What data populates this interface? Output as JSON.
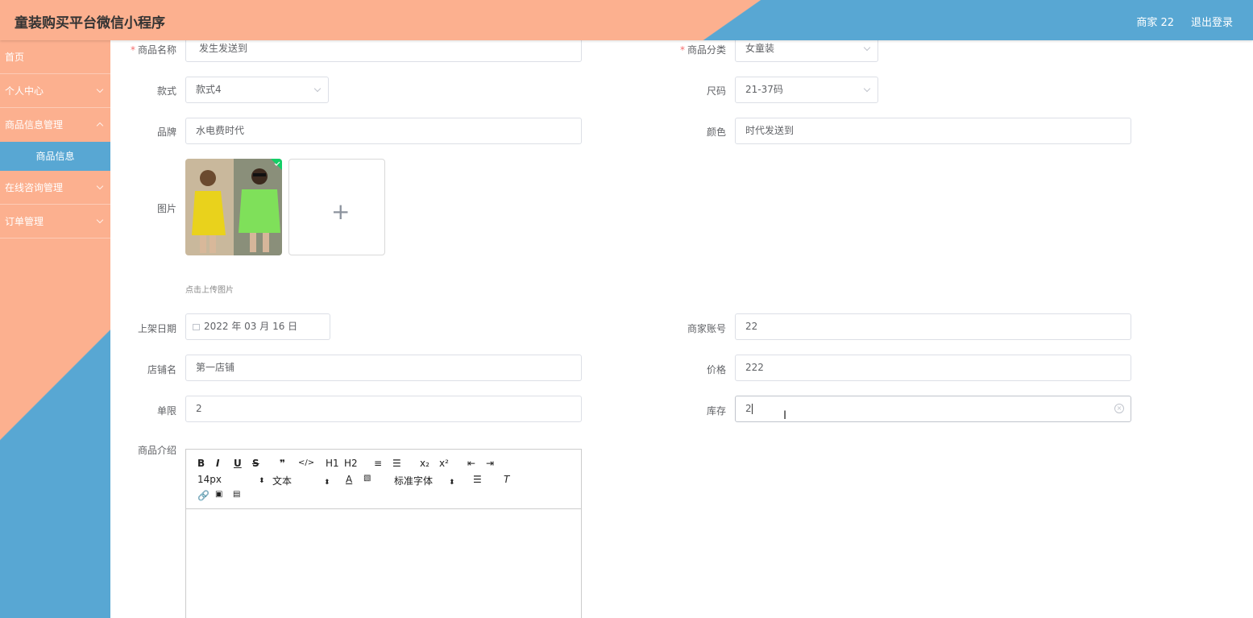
{
  "header": {
    "title": "童装购买平台微信小程序",
    "user": "商家 22",
    "logout": "退出登录"
  },
  "sidebar": {
    "items": [
      {
        "label": "首页"
      },
      {
        "label": "个人中心"
      },
      {
        "label": "商品信息管理"
      },
      {
        "label": "商品信息",
        "active": true
      },
      {
        "label": "在线咨询管理"
      },
      {
        "label": "订单管理"
      }
    ]
  },
  "form": {
    "name": {
      "label": "商品名称",
      "value": "发生发送到"
    },
    "category": {
      "label": "商品分类",
      "value": "女童装"
    },
    "style": {
      "label": "款式",
      "value": "款式4"
    },
    "size": {
      "label": "尺码",
      "value": "21-37码"
    },
    "brand": {
      "label": "品牌",
      "value": "水电费时代"
    },
    "color": {
      "label": "颜色",
      "value": "时代发送到"
    },
    "image": {
      "label": "图片",
      "tip": "点击上传图片"
    },
    "date": {
      "label": "上架日期",
      "value": "2022 年 03 月 16 日"
    },
    "account": {
      "label": "商家账号",
      "value": "22"
    },
    "shop": {
      "label": "店铺名",
      "value": "第一店铺"
    },
    "price": {
      "label": "价格",
      "value": "222"
    },
    "limit": {
      "label": "单限",
      "value": "2"
    },
    "stock": {
      "label": "库存",
      "value": "2"
    },
    "intro": {
      "label": "商品介绍"
    }
  },
  "editor": {
    "row1": [
      "B",
      "I",
      "U",
      "S",
      "❞",
      "</>",
      "H1",
      "H2",
      "≡",
      "☰",
      "x₂",
      "x²",
      "⇤",
      "⇥"
    ],
    "font_size": "14px",
    "block_type": "文本",
    "font_family": "标准字体"
  },
  "colors": {
    "header_left": "#fcb08f",
    "header_right": "#58a7d3",
    "sidebar_active": "#58a7d3"
  }
}
